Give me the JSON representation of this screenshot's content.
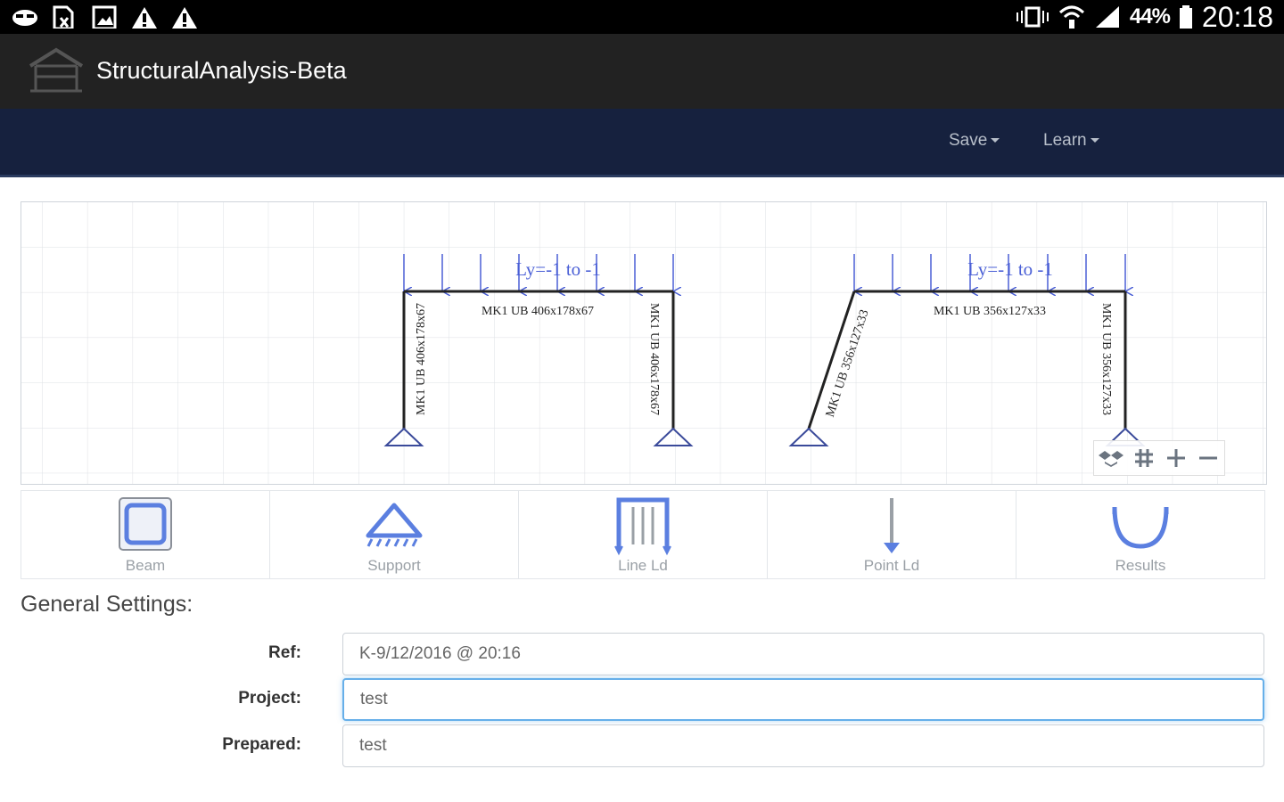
{
  "status_bar": {
    "battery_percent": "44%",
    "time": "20:18",
    "left_icons": [
      "app-notification-icon",
      "document-icon",
      "image-icon",
      "warning-icon",
      "warning-icon"
    ],
    "right_icons": [
      "vibrate-icon",
      "wifi-icon",
      "signal-icon",
      "battery-icon"
    ]
  },
  "app": {
    "title": "StructuralAnalysis-Beta"
  },
  "nav": {
    "save_label": "Save",
    "learn_label": "Learn"
  },
  "canvas": {
    "frame1": {
      "load_label": "Ly=-1 to -1",
      "beam_label": "MK1 UB 406x178x67",
      "left_column_label": "MK1 UB 406x178x67",
      "right_column_label": "MK1 UB 406x178x67"
    },
    "frame2": {
      "load_label": "Ly=-1 to -1",
      "beam_label": "MK1 UB 356x127x33",
      "left_column_label": "MK1 UB 356x127x33",
      "right_column_label": "MK1 UB 356x127x33"
    },
    "zoom_controls": [
      "dropbox-icon",
      "grid-icon",
      "zoom-in-icon",
      "zoom-out-icon"
    ]
  },
  "toolbar": {
    "tools": [
      {
        "label": "Beam",
        "icon": "beam-icon"
      },
      {
        "label": "Support",
        "icon": "support-icon"
      },
      {
        "label": "Line Ld",
        "icon": "line-load-icon"
      },
      {
        "label": "Point Ld",
        "icon": "point-load-icon"
      },
      {
        "label": "Results",
        "icon": "results-icon"
      }
    ]
  },
  "settings": {
    "title": "General Settings:",
    "ref_label": "Ref:",
    "ref_value": "K-9/12/2016 @ 20:16",
    "project_label": "Project:",
    "project_value": "test",
    "prepared_label": "Prepared:",
    "prepared_value": "test"
  },
  "colors": {
    "status_bar_bg": "#000000",
    "app_bar_bg": "#222222",
    "nav_bar_bg": "#16213e",
    "load_arrow": "#4a5fd6",
    "tool_icon": "#5b7fe0",
    "focus_border": "#66afe9"
  }
}
